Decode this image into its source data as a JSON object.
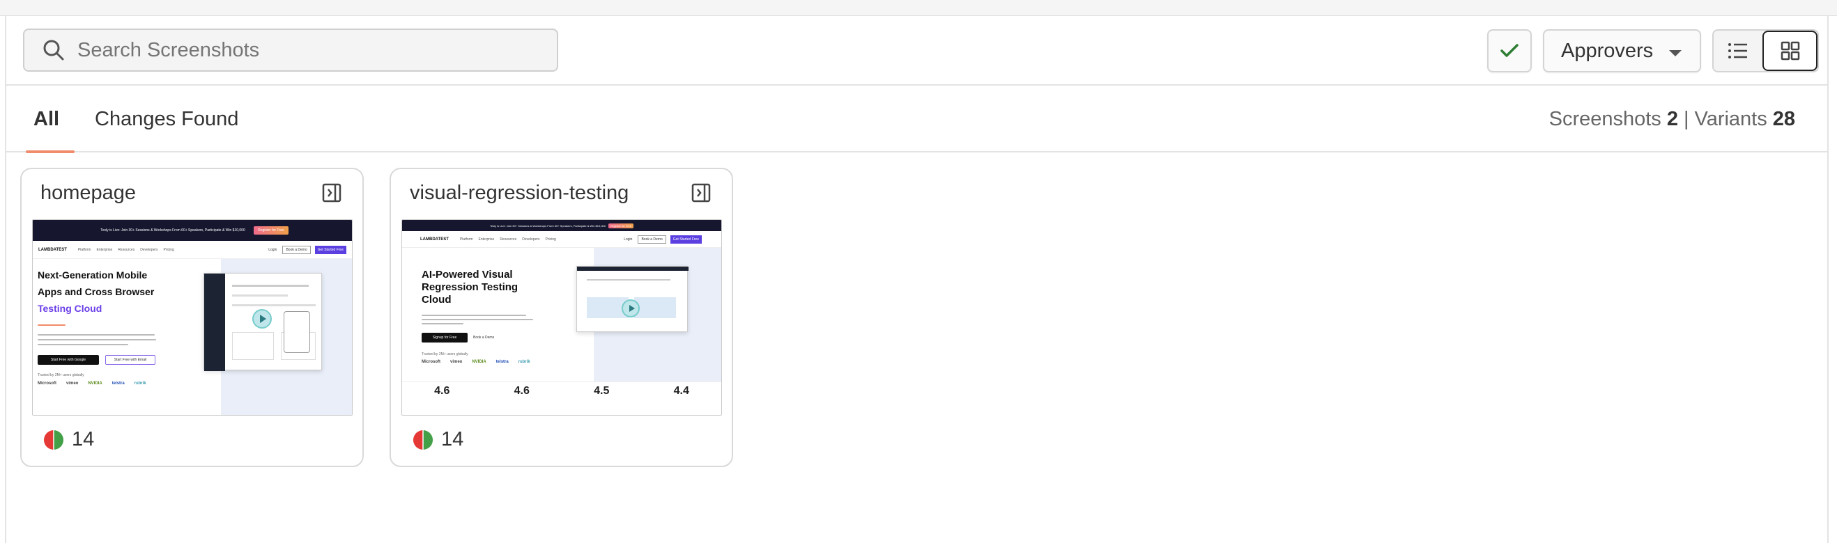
{
  "search": {
    "placeholder": "Search Screenshots",
    "value": ""
  },
  "toolbar": {
    "approvers_label": "Approvers",
    "active_view": "grid",
    "accent_check_color": "#2e7d32"
  },
  "tabs": [
    {
      "label": "All",
      "active": true
    },
    {
      "label": "Changes Found",
      "active": false
    }
  ],
  "summary": {
    "screenshots_label": "Screenshots",
    "screenshots_count": "2",
    "separator": "|",
    "variants_label": "Variants",
    "variants_count": "28"
  },
  "cards": [
    {
      "name": "homepage",
      "variant_count": "14",
      "status_colors": [
        "#e53935",
        "#43a047"
      ],
      "thumbnail": {
        "banner": "Tesly is Live: Join 30+ Sessions & Workshops From 60+ Speakers, Participate & Win $10,000",
        "banner_button": "Register for Free",
        "logo": "LAMBDATEST",
        "nav": [
          "Platform",
          "Enterprise",
          "Resources",
          "Developers",
          "Pricing"
        ],
        "login": "Login",
        "demo": "Book a Demo",
        "cta": "Get Started Free",
        "heading_1": "Next-Generation Mobile",
        "heading_2": "Apps and Cross Browser",
        "heading_accent": "Testing Cloud",
        "btn_google": "Start Free with Google",
        "btn_email": "Start Free with Email",
        "trusted": "Trusted by 2M+ users globally",
        "logos": [
          "Microsoft",
          "vimeo",
          "NVIDIA",
          "telstra",
          "rubrik"
        ]
      }
    },
    {
      "name": "visual-regression-testing",
      "variant_count": "14",
      "status_colors": [
        "#e53935",
        "#43a047"
      ],
      "thumbnail": {
        "banner": "Tesly is Live: Join 30+ Sessions & Workshops From 60+ Speakers, Participate & Win $10,000",
        "banner_button": "Register for Free",
        "logo": "LAMBDATEST",
        "nav": [
          "Platform",
          "Enterprise",
          "Resources",
          "Developers",
          "Pricing"
        ],
        "login": "Login",
        "demo": "Book a Demo",
        "cta": "Get Started Free",
        "heading_1": "AI-Powered Visual",
        "heading_2": "Regression Testing",
        "heading_3": "Cloud",
        "btn_signup": "Signup for Free",
        "btn_demo": "Book a Demo",
        "trusted": "Trusted by 2M+ users globally",
        "logos": [
          "Microsoft",
          "vimeo",
          "NVIDIA",
          "telstra",
          "rubrik"
        ],
        "ratings": [
          "4.6",
          "4.6",
          "4.5",
          "4.4"
        ]
      }
    }
  ]
}
